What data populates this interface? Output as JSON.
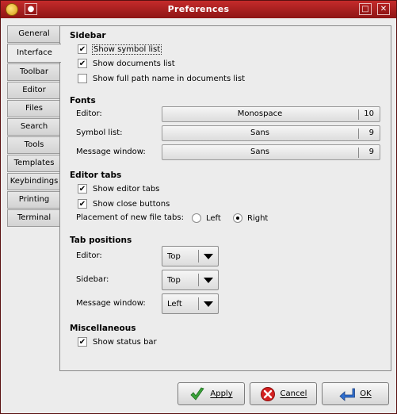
{
  "window": {
    "title": "Preferences"
  },
  "tabs": [
    "General",
    "Interface",
    "Toolbar",
    "Editor",
    "Files",
    "Search",
    "Tools",
    "Templates",
    "Keybindings",
    "Printing",
    "Terminal"
  ],
  "active_tab": "Interface",
  "sidebar": {
    "title": "Sidebar",
    "show_symbol_list": {
      "label": "Show symbol list",
      "checked": true
    },
    "show_documents_list": {
      "label": "Show documents list",
      "checked": true
    },
    "show_full_path": {
      "label": "Show full path name in documents list",
      "checked": false
    }
  },
  "fonts": {
    "title": "Fonts",
    "editor": {
      "label": "Editor:",
      "name": "Monospace",
      "size": "10"
    },
    "symbol_list": {
      "label": "Symbol list:",
      "name": "Sans",
      "size": "9"
    },
    "message_window": {
      "label": "Message window:",
      "name": "Sans",
      "size": "9"
    }
  },
  "editor_tabs": {
    "title": "Editor tabs",
    "show_editor_tabs": {
      "label": "Show editor tabs",
      "checked": true
    },
    "show_close_buttons": {
      "label": "Show close buttons",
      "checked": true
    },
    "placement_label": "Placement of new file tabs:",
    "placement_left": "Left",
    "placement_right": "Right",
    "placement_selected": "Right"
  },
  "tab_positions": {
    "title": "Tab positions",
    "editor": {
      "label": "Editor:",
      "value": "Top"
    },
    "sidebar": {
      "label": "Sidebar:",
      "value": "Top"
    },
    "message_window": {
      "label": "Message window:",
      "value": "Left"
    }
  },
  "misc": {
    "title": "Miscellaneous",
    "show_status_bar": {
      "label": "Show status bar",
      "checked": true
    }
  },
  "buttons": {
    "apply": "Apply",
    "cancel": "Cancel",
    "ok": "OK"
  },
  "colors": {
    "titlebar": "#a81f1f",
    "apply_icon": "#3aa33a",
    "cancel_icon": "#d42020",
    "ok_icon": "#2f6fd0"
  }
}
